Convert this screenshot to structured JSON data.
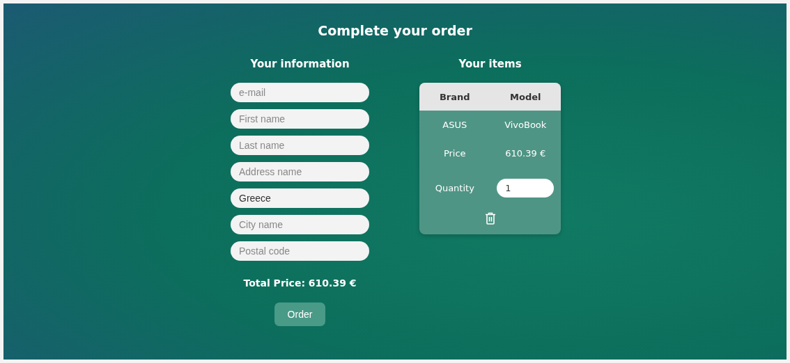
{
  "title": "Complete your order",
  "information": {
    "heading": "Your information",
    "fields": [
      {
        "placeholder": "e-mail"
      },
      {
        "placeholder": "First name"
      },
      {
        "placeholder": "Last name"
      },
      {
        "placeholder": "Address name"
      },
      {
        "value": "Greece"
      },
      {
        "placeholder": "City name"
      },
      {
        "placeholder": "Postal code"
      }
    ],
    "total": "Total Price: 610.39 €",
    "order_button": "Order"
  },
  "items": {
    "heading": "Your items",
    "columns": [
      "Brand",
      "Model"
    ],
    "products": [
      {
        "brand": "ASUS",
        "model": "VivoBook",
        "price_label": "Price",
        "price": "610.39 €",
        "quantity_label": "Quantity",
        "quantity": "1"
      }
    ]
  }
}
